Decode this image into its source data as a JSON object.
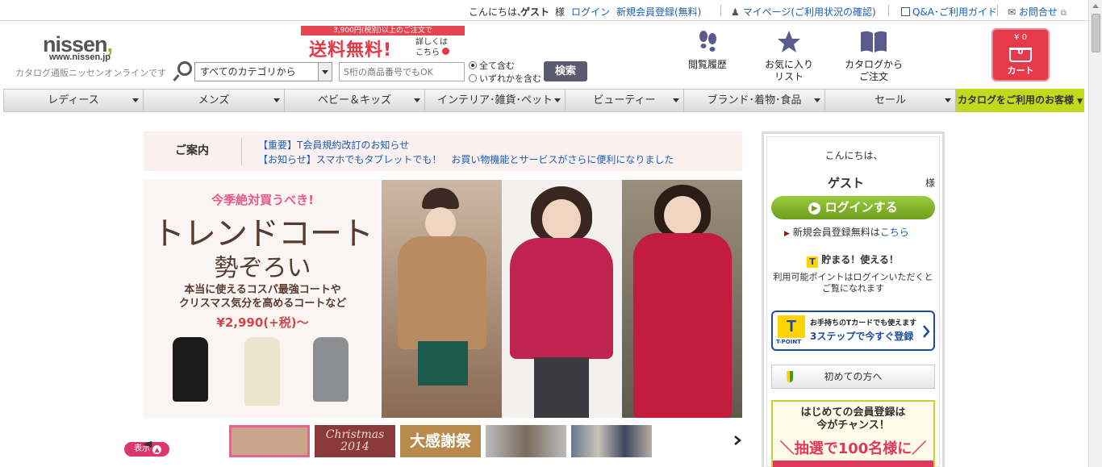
{
  "topbar": {
    "greeting": "こんにちは、",
    "guest": "ゲスト",
    "sama": "様",
    "login": "ログイン",
    "register": "新規会員登録(無料)",
    "mypage": "マイページ(ご利用状況の確認)",
    "qa": "Q&A･ご利用ガイド",
    "contact": "お問合せ"
  },
  "header": {
    "logo": "nissen",
    "logo_url": "www.nissen.jp",
    "logo_sub": "カタログ通販ニッセンオンラインです",
    "promo_top": "3,900円(税別)以上のご注文で",
    "promo_big": "送料無料!",
    "promo_side1": "詳しくは",
    "promo_side2": "こちら"
  },
  "search": {
    "category": "すべてのカテゴリから",
    "placeholder": "5桁の商品番号でもOK",
    "radio_all": "全て含む",
    "radio_any": "いずれかを含む",
    "button": "検索"
  },
  "nav_icons": {
    "history": "閲覧履歴",
    "favorites_1": "お気に入り",
    "favorites_2": "リスト",
    "catalog_1": "カタログから",
    "catalog_2": "ご注文",
    "cart_yen": "¥ 0",
    "cart_count": "0",
    "cart": "カート"
  },
  "categories": [
    "レディース",
    "メンズ",
    "ベビー＆キッズ",
    "インテリア･雑貨･ペット",
    "ビューティー",
    "ブランド･着物･食品",
    "セール"
  ],
  "catalog_users": "カタログをご利用のお客様",
  "notice": {
    "label": "ご案内",
    "items": [
      "【重要】T会員規約改訂のお知らせ",
      "【お知らせ】スマホでもタブレットでも！　お買い物機能とサービスがさらに便利になりました"
    ]
  },
  "hero": {
    "line1": "今季絶対買うべき!",
    "line2": "トレンドコート",
    "line3": "勢ぞろい",
    "line4a": "本当に使えるコスパ最強コートや",
    "line4b": "クリスマス気分を高めるコートなど",
    "price": "¥2,990(+税)～"
  },
  "thumbs": {
    "christmas1": "Christmas",
    "christmas2": "2014",
    "thanks": "大感謝祭"
  },
  "display_toggle": "表示",
  "sidebar": {
    "hello": "こんにちは、",
    "guest": "ゲスト",
    "sama": "様",
    "login_button": "ログインする",
    "register_prefix": "新規会員登録無料は",
    "register_link": "こちら",
    "tpoint_heading": "貯まる！使える！",
    "tpoint_text1": "利用可能ポイントはログインいただくと",
    "tpoint_text2": "ご覧になれます",
    "tbanner_1": "お手持ちのTカードでも使えます",
    "tbanner_2": "3ステップで今すぐ登録",
    "tbanner_logo": "T-POINT",
    "first_time": "初めての方へ",
    "member_1": "はじめての会員登録は",
    "member_2": "今がチャンス！",
    "member_3": "＼抽選で100名様に／"
  }
}
